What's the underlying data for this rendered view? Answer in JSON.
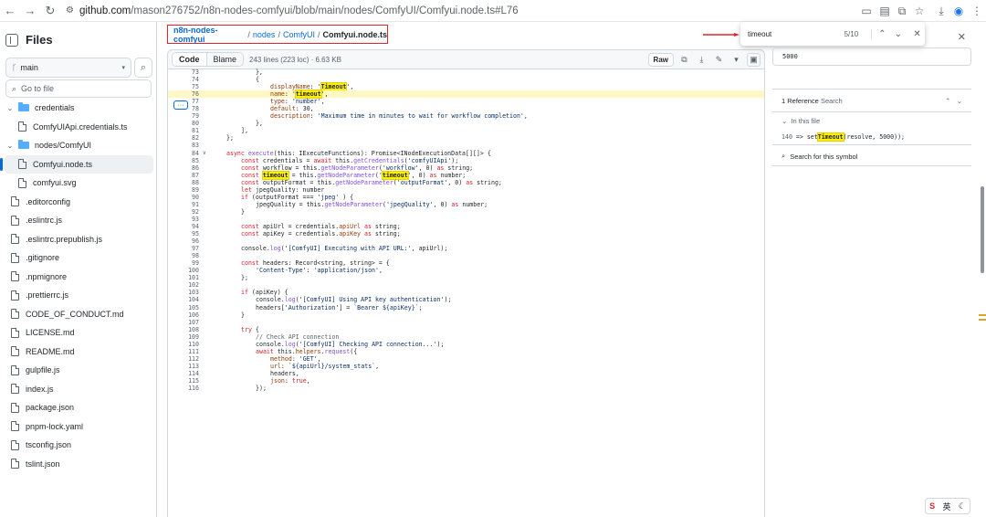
{
  "browser": {
    "url_host": "github.com",
    "url_path": "/mason276752/n8n-nodes-comfyui/blob/main/nodes/ComfyUI/Comfyui.node.ts#L76"
  },
  "sidebar": {
    "title": "Files",
    "branch": "main",
    "goto_placeholder": "Go to file",
    "items": [
      {
        "label": "credentials",
        "type": "folder",
        "depth": 0
      },
      {
        "label": "ComfyUIApi.credentials.ts",
        "type": "file",
        "depth": 1
      },
      {
        "label": "nodes/ComfyUI",
        "type": "folder",
        "depth": 0
      },
      {
        "label": "Comfyui.node.ts",
        "type": "file",
        "depth": 1,
        "selected": true
      },
      {
        "label": "comfyui.svg",
        "type": "file",
        "depth": 1
      },
      {
        "label": ".editorconfig",
        "type": "file",
        "depth": 0
      },
      {
        "label": ".eslintrc.js",
        "type": "file",
        "depth": 0
      },
      {
        "label": ".eslintrc.prepublish.js",
        "type": "file",
        "depth": 0
      },
      {
        "label": ".gitignore",
        "type": "file",
        "depth": 0
      },
      {
        "label": ".npmignore",
        "type": "file",
        "depth": 0
      },
      {
        "label": ".prettierrc.js",
        "type": "file",
        "depth": 0
      },
      {
        "label": "CODE_OF_CONDUCT.md",
        "type": "file",
        "depth": 0
      },
      {
        "label": "LICENSE.md",
        "type": "file",
        "depth": 0
      },
      {
        "label": "README.md",
        "type": "file",
        "depth": 0
      },
      {
        "label": "gulpfile.js",
        "type": "file",
        "depth": 0
      },
      {
        "label": "index.js",
        "type": "file",
        "depth": 0
      },
      {
        "label": "package.json",
        "type": "file",
        "depth": 0
      },
      {
        "label": "pnpm-lock.yaml",
        "type": "file",
        "depth": 0
      },
      {
        "label": "tsconfig.json",
        "type": "file",
        "depth": 0
      },
      {
        "label": "tslint.json",
        "type": "file",
        "depth": 0
      }
    ]
  },
  "breadcrumb": {
    "repo": "n8n-nodes-comfyui",
    "p1": "nodes",
    "p2": "ComfyUI",
    "file": "Comfyui.node.ts"
  },
  "codeview": {
    "tab_code": "Code",
    "tab_blame": "Blame",
    "meta": "243 lines (223 loc) · 6.63 KB",
    "raw": "Raw"
  },
  "find": {
    "query": "timeout",
    "count": "5/10"
  },
  "panel": {
    "symbol": "5000",
    "ref_count": "1 Reference",
    "ref_search": "Search",
    "in_file": "In this file",
    "ref_line_no": "140",
    "ref_pre": "=> set",
    "ref_mk": "Timeout",
    "ref_post": "(resolve, 5000));",
    "search_symbol": "Search for this symbol"
  },
  "ime": {
    "label": "英"
  },
  "code": [
    {
      "n": "73",
      "s": [
        [
          "",
          "},"
        ]
      ],
      "i": 3
    },
    {
      "n": "74",
      "s": [
        [
          "",
          "{"
        ]
      ],
      "i": 3
    },
    {
      "n": "75",
      "s": [
        [
          "pr",
          "displayName"
        ],
        [
          "",
          ": "
        ],
        [
          "st",
          "'"
        ],
        [
          "mk",
          "Timeout"
        ],
        [
          "st",
          "'"
        ],
        [
          "",
          ","
        ]
      ],
      "i": 4
    },
    {
      "n": "76",
      "s": [
        [
          "pr",
          "name"
        ],
        [
          "",
          ": "
        ],
        [
          "st",
          "'"
        ],
        [
          "mk",
          "timeout"
        ],
        [
          "st",
          "'"
        ],
        [
          "",
          ","
        ]
      ],
      "i": 4,
      "hl": true
    },
    {
      "n": "77",
      "s": [
        [
          "pr",
          "type"
        ],
        [
          "",
          ": "
        ],
        [
          "st",
          "'number'"
        ],
        [
          "",
          ","
        ]
      ],
      "i": 4
    },
    {
      "n": "78",
      "s": [
        [
          "pr",
          "default"
        ],
        [
          "",
          ": 30,"
        ]
      ],
      "i": 4
    },
    {
      "n": "79",
      "s": [
        [
          "pr",
          "description"
        ],
        [
          "",
          ": "
        ],
        [
          "st",
          "'Maximum time in minutes to wait for workflow completion'"
        ],
        [
          "",
          ","
        ]
      ],
      "i": 4
    },
    {
      "n": "80",
      "s": [
        [
          "",
          "},"
        ]
      ],
      "i": 3
    },
    {
      "n": "81",
      "s": [
        [
          "",
          "],"
        ]
      ],
      "i": 2
    },
    {
      "n": "82",
      "s": [
        [
          "",
          "};"
        ]
      ],
      "i": 1
    },
    {
      "n": "83",
      "s": [
        [
          "",
          ""
        ]
      ],
      "i": 0
    },
    {
      "n": "84",
      "s": [
        [
          "kw",
          "async "
        ],
        [
          "fn",
          "execute"
        ],
        [
          "",
          "(this: IExecuteFunctions): Promise<INodeExecutionData[][]> {"
        ]
      ],
      "i": 1,
      "fold": "∨"
    },
    {
      "n": "85",
      "s": [
        [
          "kw",
          "const "
        ],
        [
          "",
          "credentials = "
        ],
        [
          "kw",
          "await "
        ],
        [
          "",
          "this."
        ],
        [
          "fn",
          "getCredentials"
        ],
        [
          "",
          "("
        ],
        [
          "st",
          "'comfyUIApi'"
        ],
        [
          "",
          ");"
        ]
      ],
      "i": 2
    },
    {
      "n": "86",
      "s": [
        [
          "kw",
          "const "
        ],
        [
          "",
          "workflow = this."
        ],
        [
          "fn",
          "getNodeParameter"
        ],
        [
          "",
          "("
        ],
        [
          "st",
          "'workflow'"
        ],
        [
          "",
          ", 0) "
        ],
        [
          "kw",
          "as "
        ],
        [
          "",
          "string;"
        ]
      ],
      "i": 2
    },
    {
      "n": "87",
      "s": [
        [
          "kw",
          "const "
        ],
        [
          "mk",
          "timeout"
        ],
        [
          "",
          " = this."
        ],
        [
          "fn",
          "getNodeParameter"
        ],
        [
          "",
          "("
        ],
        [
          "st",
          "'"
        ],
        [
          "mk",
          "timeout"
        ],
        [
          "st",
          "'"
        ],
        [
          "",
          ", 0) "
        ],
        [
          "kw",
          "as "
        ],
        [
          "",
          "number;"
        ]
      ],
      "i": 2
    },
    {
      "n": "88",
      "s": [
        [
          "kw",
          "const "
        ],
        [
          "",
          "outputFormat = this."
        ],
        [
          "fn",
          "getNodeParameter"
        ],
        [
          "",
          "("
        ],
        [
          "st",
          "'outputFormat'"
        ],
        [
          "",
          ", 0) "
        ],
        [
          "kw",
          "as "
        ],
        [
          "",
          "string;"
        ]
      ],
      "i": 2
    },
    {
      "n": "89",
      "s": [
        [
          "kw",
          "let "
        ],
        [
          "",
          "jpegQuality: number"
        ]
      ],
      "i": 2
    },
    {
      "n": "90",
      "s": [
        [
          "kw",
          "if "
        ],
        [
          "",
          "(outputFormat === "
        ],
        [
          "st",
          "'jpeg'"
        ],
        [
          "",
          " ) {"
        ]
      ],
      "i": 2
    },
    {
      "n": "91",
      "s": [
        [
          "",
          "jpegQuality = this."
        ],
        [
          "fn",
          "getNodeParameter"
        ],
        [
          "",
          "("
        ],
        [
          "st",
          "'jpegQuality'"
        ],
        [
          "",
          ", 0) "
        ],
        [
          "kw",
          "as "
        ],
        [
          "",
          "number;"
        ]
      ],
      "i": 3
    },
    {
      "n": "92",
      "s": [
        [
          "",
          "}"
        ]
      ],
      "i": 2
    },
    {
      "n": "93",
      "s": [
        [
          "",
          ""
        ]
      ],
      "i": 0
    },
    {
      "n": "94",
      "s": [
        [
          "kw",
          "const "
        ],
        [
          "",
          "apiUrl = credentials."
        ],
        [
          "pr",
          "apiUrl"
        ],
        [
          "kw",
          " as "
        ],
        [
          "",
          "string;"
        ]
      ],
      "i": 2
    },
    {
      "n": "95",
      "s": [
        [
          "kw",
          "const "
        ],
        [
          "",
          "apiKey = credentials."
        ],
        [
          "pr",
          "apiKey"
        ],
        [
          "kw",
          " as "
        ],
        [
          "",
          "string;"
        ]
      ],
      "i": 2
    },
    {
      "n": "96",
      "s": [
        [
          "",
          ""
        ]
      ],
      "i": 0
    },
    {
      "n": "97",
      "s": [
        [
          "",
          "console."
        ],
        [
          "fn",
          "log"
        ],
        [
          "",
          "("
        ],
        [
          "st",
          "'[ComfyUI] Executing with API URL:'"
        ],
        [
          "",
          ", apiUrl);"
        ]
      ],
      "i": 2
    },
    {
      "n": "98",
      "s": [
        [
          "",
          ""
        ]
      ],
      "i": 0
    },
    {
      "n": "99",
      "s": [
        [
          "kw",
          "const "
        ],
        [
          "",
          "headers: Record<string, string> = {"
        ]
      ],
      "i": 2
    },
    {
      "n": "100",
      "s": [
        [
          "st",
          "'Content-Type'"
        ],
        [
          "",
          ": "
        ],
        [
          "st",
          "'application/json'"
        ],
        [
          "",
          ","
        ]
      ],
      "i": 3
    },
    {
      "n": "101",
      "s": [
        [
          "",
          "};"
        ]
      ],
      "i": 2
    },
    {
      "n": "102",
      "s": [
        [
          "",
          ""
        ]
      ],
      "i": 0
    },
    {
      "n": "103",
      "s": [
        [
          "kw",
          "if "
        ],
        [
          "",
          "(apiKey) {"
        ]
      ],
      "i": 2
    },
    {
      "n": "104",
      "s": [
        [
          "",
          "console."
        ],
        [
          "fn",
          "log"
        ],
        [
          "",
          "("
        ],
        [
          "st",
          "'[ComfyUI] Using API key authentication'"
        ],
        [
          "",
          ");"
        ]
      ],
      "i": 3
    },
    {
      "n": "105",
      "s": [
        [
          "",
          "headers["
        ],
        [
          "st",
          "'Authorization'"
        ],
        [
          "",
          "] = "
        ],
        [
          "st",
          "`Bearer ${apiKey}`"
        ],
        [
          "",
          ";"
        ]
      ],
      "i": 3
    },
    {
      "n": "106",
      "s": [
        [
          "",
          "}"
        ]
      ],
      "i": 2
    },
    {
      "n": "107",
      "s": [
        [
          "",
          ""
        ]
      ],
      "i": 0
    },
    {
      "n": "108",
      "s": [
        [
          "kw",
          "try "
        ],
        [
          "",
          "{"
        ]
      ],
      "i": 2
    },
    {
      "n": "109",
      "s": [
        [
          "cm",
          "// Check API connection"
        ]
      ],
      "i": 3
    },
    {
      "n": "110",
      "s": [
        [
          "",
          "console."
        ],
        [
          "fn",
          "log"
        ],
        [
          "",
          "("
        ],
        [
          "st",
          "'[ComfyUI] Checking API connection...'"
        ],
        [
          "",
          ");"
        ]
      ],
      "i": 3
    },
    {
      "n": "111",
      "s": [
        [
          "kw",
          "await "
        ],
        [
          "",
          "this."
        ],
        [
          "pr",
          "helpers"
        ],
        [
          "",
          "."
        ],
        [
          "fn",
          "request"
        ],
        [
          "",
          "({"
        ]
      ],
      "i": 3
    },
    {
      "n": "112",
      "s": [
        [
          "pr",
          "method"
        ],
        [
          "",
          ": "
        ],
        [
          "st",
          "'GET'"
        ],
        [
          "",
          ","
        ]
      ],
      "i": 4
    },
    {
      "n": "113",
      "s": [
        [
          "pr",
          "url"
        ],
        [
          "",
          ": "
        ],
        [
          "st",
          "`${apiUrl}/system_stats`"
        ],
        [
          "",
          ","
        ]
      ],
      "i": 4
    },
    {
      "n": "114",
      "s": [
        [
          "",
          "headers,"
        ]
      ],
      "i": 4
    },
    {
      "n": "115",
      "s": [
        [
          "pr",
          "json"
        ],
        [
          "",
          ": "
        ],
        [
          "kw",
          "true"
        ],
        [
          "",
          ","
        ]
      ],
      "i": 4
    },
    {
      "n": "116",
      "s": [
        [
          "",
          "});"
        ]
      ],
      "i": 3
    }
  ]
}
